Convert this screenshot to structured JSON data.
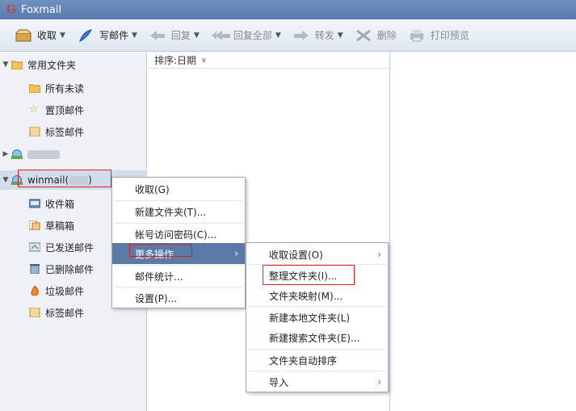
{
  "app": {
    "title": "Foxmail",
    "logo": "G"
  },
  "toolbar": {
    "receive": "收取",
    "compose": "写邮件",
    "reply": "回复",
    "reply_all": "回复全部",
    "forward": "转发",
    "delete": "删除",
    "print_preview": "打印预览"
  },
  "sidebar": {
    "common_folders": "常用文件夹",
    "all_unread": "所有未读",
    "pinned": "置顶邮件",
    "tagged": "标签邮件",
    "account1": "",
    "account2": "winmail(",
    "account2_suffix": ")",
    "inbox": "收件箱",
    "drafts": "草稿箱",
    "sent": "已发送邮件",
    "deleted": "已删除邮件",
    "spam": "垃圾邮件",
    "tagged2": "标签邮件"
  },
  "list": {
    "sort_label": "排序:日期"
  },
  "context_menu": {
    "receive": "收取(G)",
    "new_folder": "新建文件夹(T)...",
    "account_password": "帐号访问密码(C)...",
    "more_actions": "更多操作",
    "mail_stats": "邮件统计...",
    "settings": "设置(P)..."
  },
  "submenu": {
    "receive_settings": "收取设置(O)",
    "organize_folder": "整理文件夹(I)...",
    "folder_mapping": "文件夹映射(M)...",
    "new_local_folder": "新建本地文件夹(L)",
    "new_search_folder": "新建搜索文件夹(E)...",
    "auto_sort": "文件夹自动排序",
    "import": "导入"
  },
  "colors": {
    "highlight": "#5b7ba6",
    "annotation": "#e02020"
  }
}
